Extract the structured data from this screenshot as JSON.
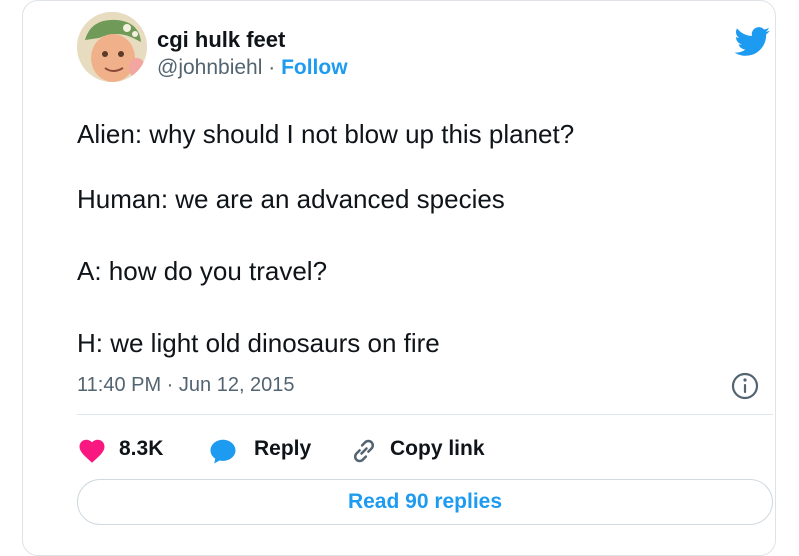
{
  "tweet": {
    "display_name": "cgi hulk feet",
    "handle": "@johnbiehl",
    "separator": " · ",
    "follow_label": "Follow",
    "lines": [
      "Alien: why should I not blow up this planet?",
      "Human: we are an advanced species",
      "A: how do you travel?",
      "H: we light old dinosaurs on fire"
    ],
    "timestamp": "11:40 PM · Jun 12, 2015",
    "likes": "8.3K",
    "reply_label": "Reply",
    "copy_link_label": "Copy link",
    "read_replies_label": "Read 90 replies"
  },
  "colors": {
    "twitter_blue": "#1d9bf0",
    "like_red": "#f91880",
    "text": "#0f1419",
    "muted": "#536471"
  },
  "icons": [
    "twitter-bird-icon",
    "info-icon",
    "heart-icon",
    "reply-bubble-icon",
    "link-icon"
  ]
}
